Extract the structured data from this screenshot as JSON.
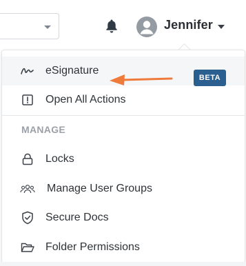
{
  "header": {
    "user_name": "Jennifer",
    "icons": [
      "select-caret-icon",
      "bell-icon",
      "user-avatar-icon",
      "user-caret-icon"
    ]
  },
  "menu": {
    "top_items": [
      {
        "label": "eSignature",
        "icon": "signature-icon",
        "badge": "BETA",
        "highlighted": true
      },
      {
        "label": "Open All Actions",
        "icon": "exclamation-box-icon"
      }
    ],
    "section_title": "MANAGE",
    "manage_items": [
      {
        "label": "Locks",
        "icon": "lock-icon"
      },
      {
        "label": "Manage User Groups",
        "icon": "users-icon"
      },
      {
        "label": "Secure Docs",
        "icon": "shield-check-icon"
      },
      {
        "label": "Folder Permissions",
        "icon": "folder-open-icon"
      }
    ]
  },
  "colors": {
    "badge_bg": "#2a5f8f",
    "annotation_arrow": "#f07a3a",
    "highlight_bg": "#f4f6f7",
    "section_title": "#9aa1a8"
  }
}
